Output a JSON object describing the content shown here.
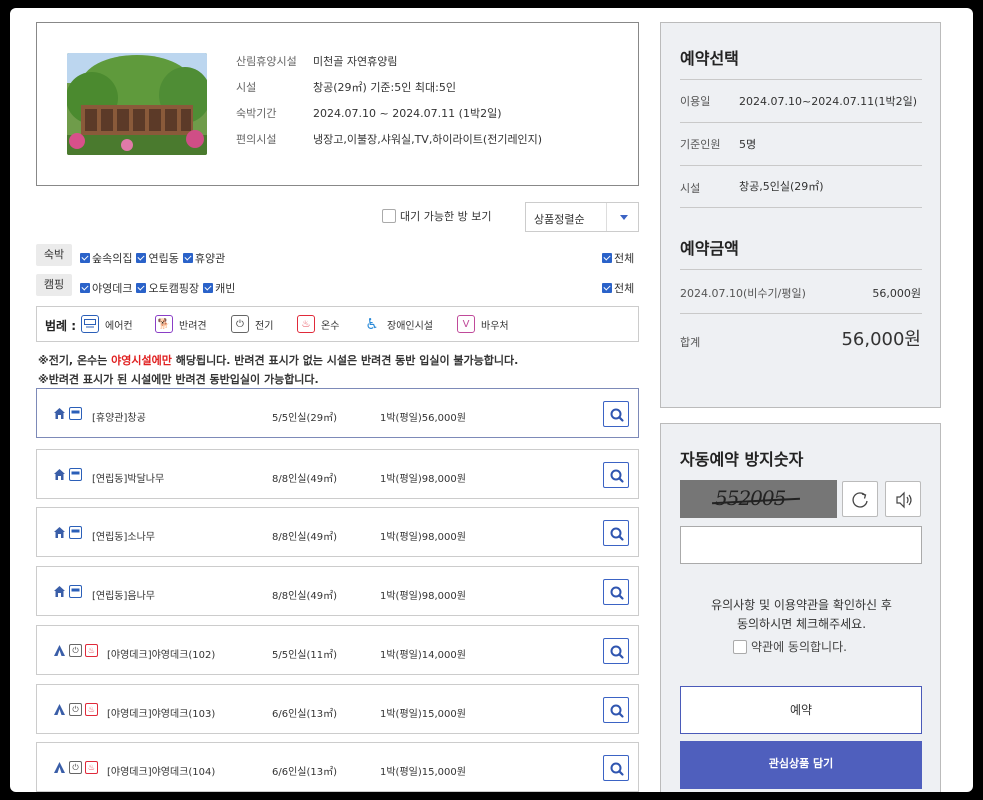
{
  "facility": {
    "rows": [
      {
        "label": "산림휴양시설",
        "value": "미천골 자연휴양림"
      },
      {
        "label": "시설",
        "value": "창공(29㎡) 기준:5인 최대:5인"
      },
      {
        "label": "숙박기간",
        "value": "2024.07.10 ~ 2024.07.11 (1박2일)"
      },
      {
        "label": "편의시설",
        "value": "냉장고,이불장,샤워실,TV,하이라이트(전기레인지)"
      }
    ]
  },
  "filters": {
    "available_only_label": "대기 가능한 방 보기",
    "sort_label": "상품정렬순",
    "lodging": {
      "tag": "숙박",
      "items": [
        "숲속의집",
        "연립동",
        "휴양관"
      ],
      "all_label": "전체"
    },
    "camping": {
      "tag": "캠핑",
      "items": [
        "야영데크",
        "오토캠핑장",
        "캐빈"
      ],
      "all_label": "전체"
    }
  },
  "legend": {
    "title": "범례 :",
    "items": [
      {
        "icon": "aircon-icon",
        "label": "에어컨"
      },
      {
        "icon": "pet-icon",
        "label": "반려견"
      },
      {
        "icon": "electric-icon",
        "label": "전기"
      },
      {
        "icon": "hot-water-icon",
        "label": "온수"
      },
      {
        "icon": "accessible-icon",
        "label": "장애인시설"
      },
      {
        "icon": "voucher-icon",
        "label": "바우처"
      }
    ]
  },
  "notices": {
    "line1_prefix": "※전기, 온수는 ",
    "line1_highlight": "야영시설에만",
    "line1_suffix": " 해당됩니다. 반려견 표시가 없는 시설은 반려견 동반 입실이 불가능합니다.",
    "line2": "※반려견 표시가 된 시설에만 반려견 동반입실이 가능합니다."
  },
  "rooms": [
    {
      "type": "house",
      "name": "[휴양관]창공",
      "capacity": "5/5인실(29㎡)",
      "price": "1박(평일)56,000원",
      "selected": true
    },
    {
      "type": "house",
      "name": "[연립동]박달나무",
      "capacity": "8/8인실(49㎡)",
      "price": "1박(평일)98,000원"
    },
    {
      "type": "house",
      "name": "[연립동]소나무",
      "capacity": "8/8인실(49㎡)",
      "price": "1박(평일)98,000원"
    },
    {
      "type": "house",
      "name": "[연립동]음나무",
      "capacity": "8/8인실(49㎡)",
      "price": "1박(평일)98,000원"
    },
    {
      "type": "tent",
      "name": "[야영데크]야영데크(102)",
      "capacity": "5/5인실(11㎡)",
      "price": "1박(평일)14,000원"
    },
    {
      "type": "tent",
      "name": "[야영데크]야영데크(103)",
      "capacity": "6/6인실(13㎡)",
      "price": "1박(평일)15,000원"
    },
    {
      "type": "tent",
      "name": "[야영데크]야영데크(104)",
      "capacity": "6/6인실(13㎡)",
      "price": "1박(평일)15,000원"
    }
  ],
  "reservation": {
    "title": "예약선택",
    "rows": [
      {
        "label": "이용일",
        "value": "2024.07.10~2024.07.11(1박2일)"
      },
      {
        "label": "기준인원",
        "value": "5명"
      },
      {
        "label": "시설",
        "value": "창공,5인실(29㎡)"
      }
    ],
    "price_title": "예약금액",
    "price_line_label": "2024.07.10(비수기/평일)",
    "price_line_value": "56,000원",
    "total_label": "합계",
    "total_value": "56,000원"
  },
  "captcha": {
    "title": "자동예약 방지숫자",
    "code": "552005",
    "input_value": "",
    "agree_line1": "유의사항 및 이용약관을 확인하신 후",
    "agree_line2": "동의하시면 체크해주세요.",
    "agree_checkbox_label": "약관에 동의합니다.",
    "reserve_label": "예약",
    "wishlist_label": "관심상품 담기"
  },
  "colors": {
    "accent": "#3b63c4",
    "wish_button": "#4f5fbd",
    "notice_red": "#e02020"
  }
}
